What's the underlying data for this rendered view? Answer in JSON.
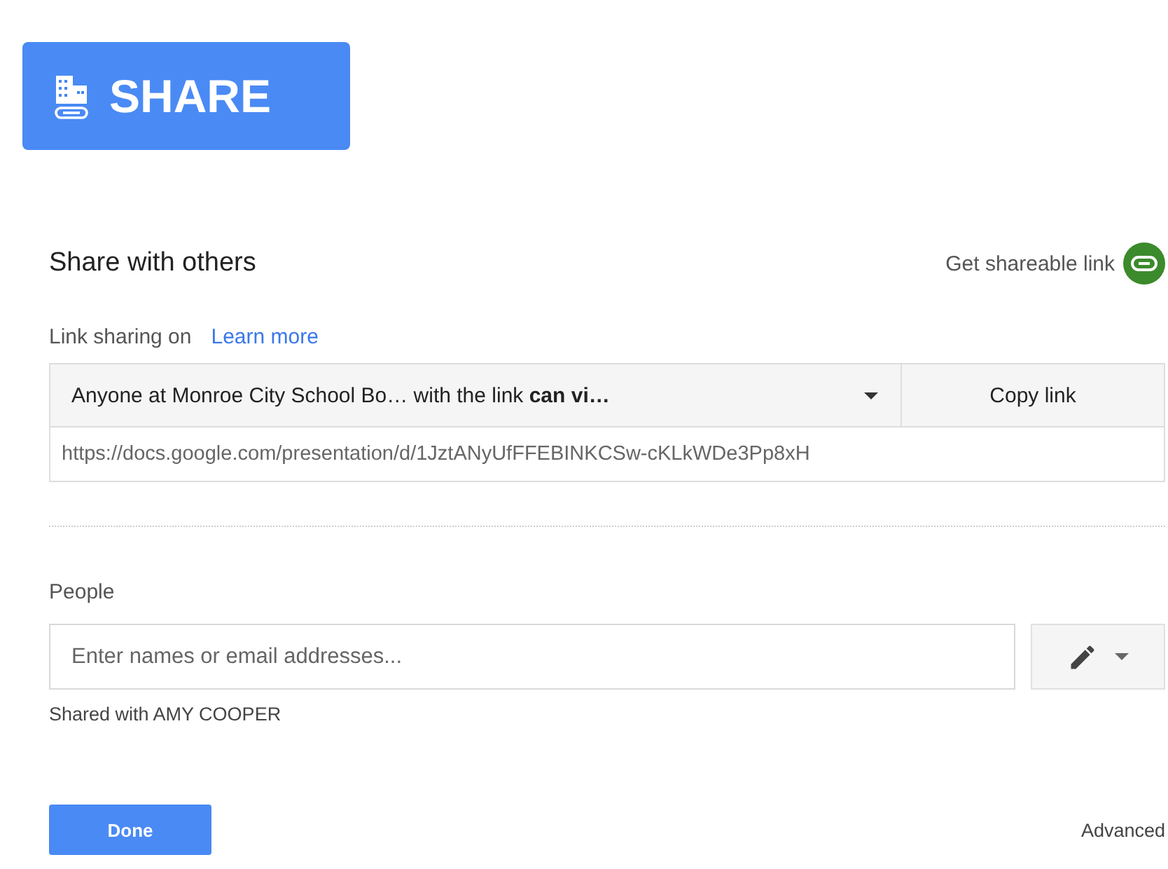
{
  "share_button": {
    "label": "SHARE"
  },
  "dialog": {
    "title": "Share with others",
    "get_link": "Get shareable link",
    "link_sharing": {
      "status": "Link sharing on",
      "learn_more": "Learn more",
      "access": "Anyone at Monroe City School Bo…  with the link **can vi…**",
      "copy_button": "Copy link",
      "url": "https://docs.google.com/presentation/d/1JztANyUfFFEBINKCSw-cKLkWDe3Pp8xH"
    },
    "people": {
      "label": "People",
      "placeholder": "Enter names or email addresses...",
      "shared_with": "Shared with AMY COOPER"
    },
    "done_button": "Done",
    "advanced": "Advanced"
  }
}
